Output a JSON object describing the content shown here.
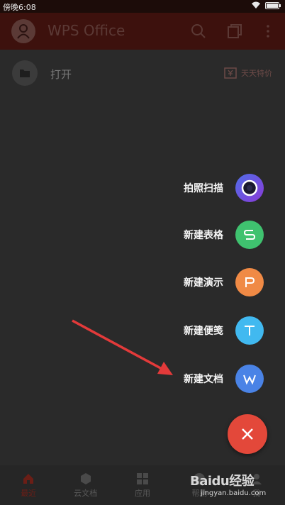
{
  "status_bar": {
    "time": "傍晚6:08"
  },
  "app_bar": {
    "title": "WPS Office"
  },
  "open_row": {
    "label": "打开",
    "promo_label": "天天特价"
  },
  "fab_menu": {
    "items": [
      {
        "label": "拍照扫描",
        "color": "#6a3de0",
        "icon": "camera-scan-icon"
      },
      {
        "label": "新建表格",
        "color": "#3fc26f",
        "icon": "spreadsheet-s-icon"
      },
      {
        "label": "新建演示",
        "color": "#f08a45",
        "icon": "presentation-p-icon"
      },
      {
        "label": "新建便笺",
        "color": "#41b9f0",
        "icon": "note-t-icon"
      },
      {
        "label": "新建文档",
        "color": "#4a83e6",
        "icon": "document-w-icon"
      }
    ],
    "close_color": "#e3483a"
  },
  "bottom_nav": {
    "tabs": [
      {
        "label": "最近",
        "active": true
      },
      {
        "label": "云文档",
        "active": false
      },
      {
        "label": "应用",
        "active": false
      },
      {
        "label": "帮助",
        "active": false
      },
      {
        "label": "我",
        "active": false
      }
    ]
  },
  "watermark": {
    "logo": "Baidu经验",
    "url": "jingyan.baidu.com"
  },
  "annotation": {
    "arrow_color": "#e33a3a"
  }
}
